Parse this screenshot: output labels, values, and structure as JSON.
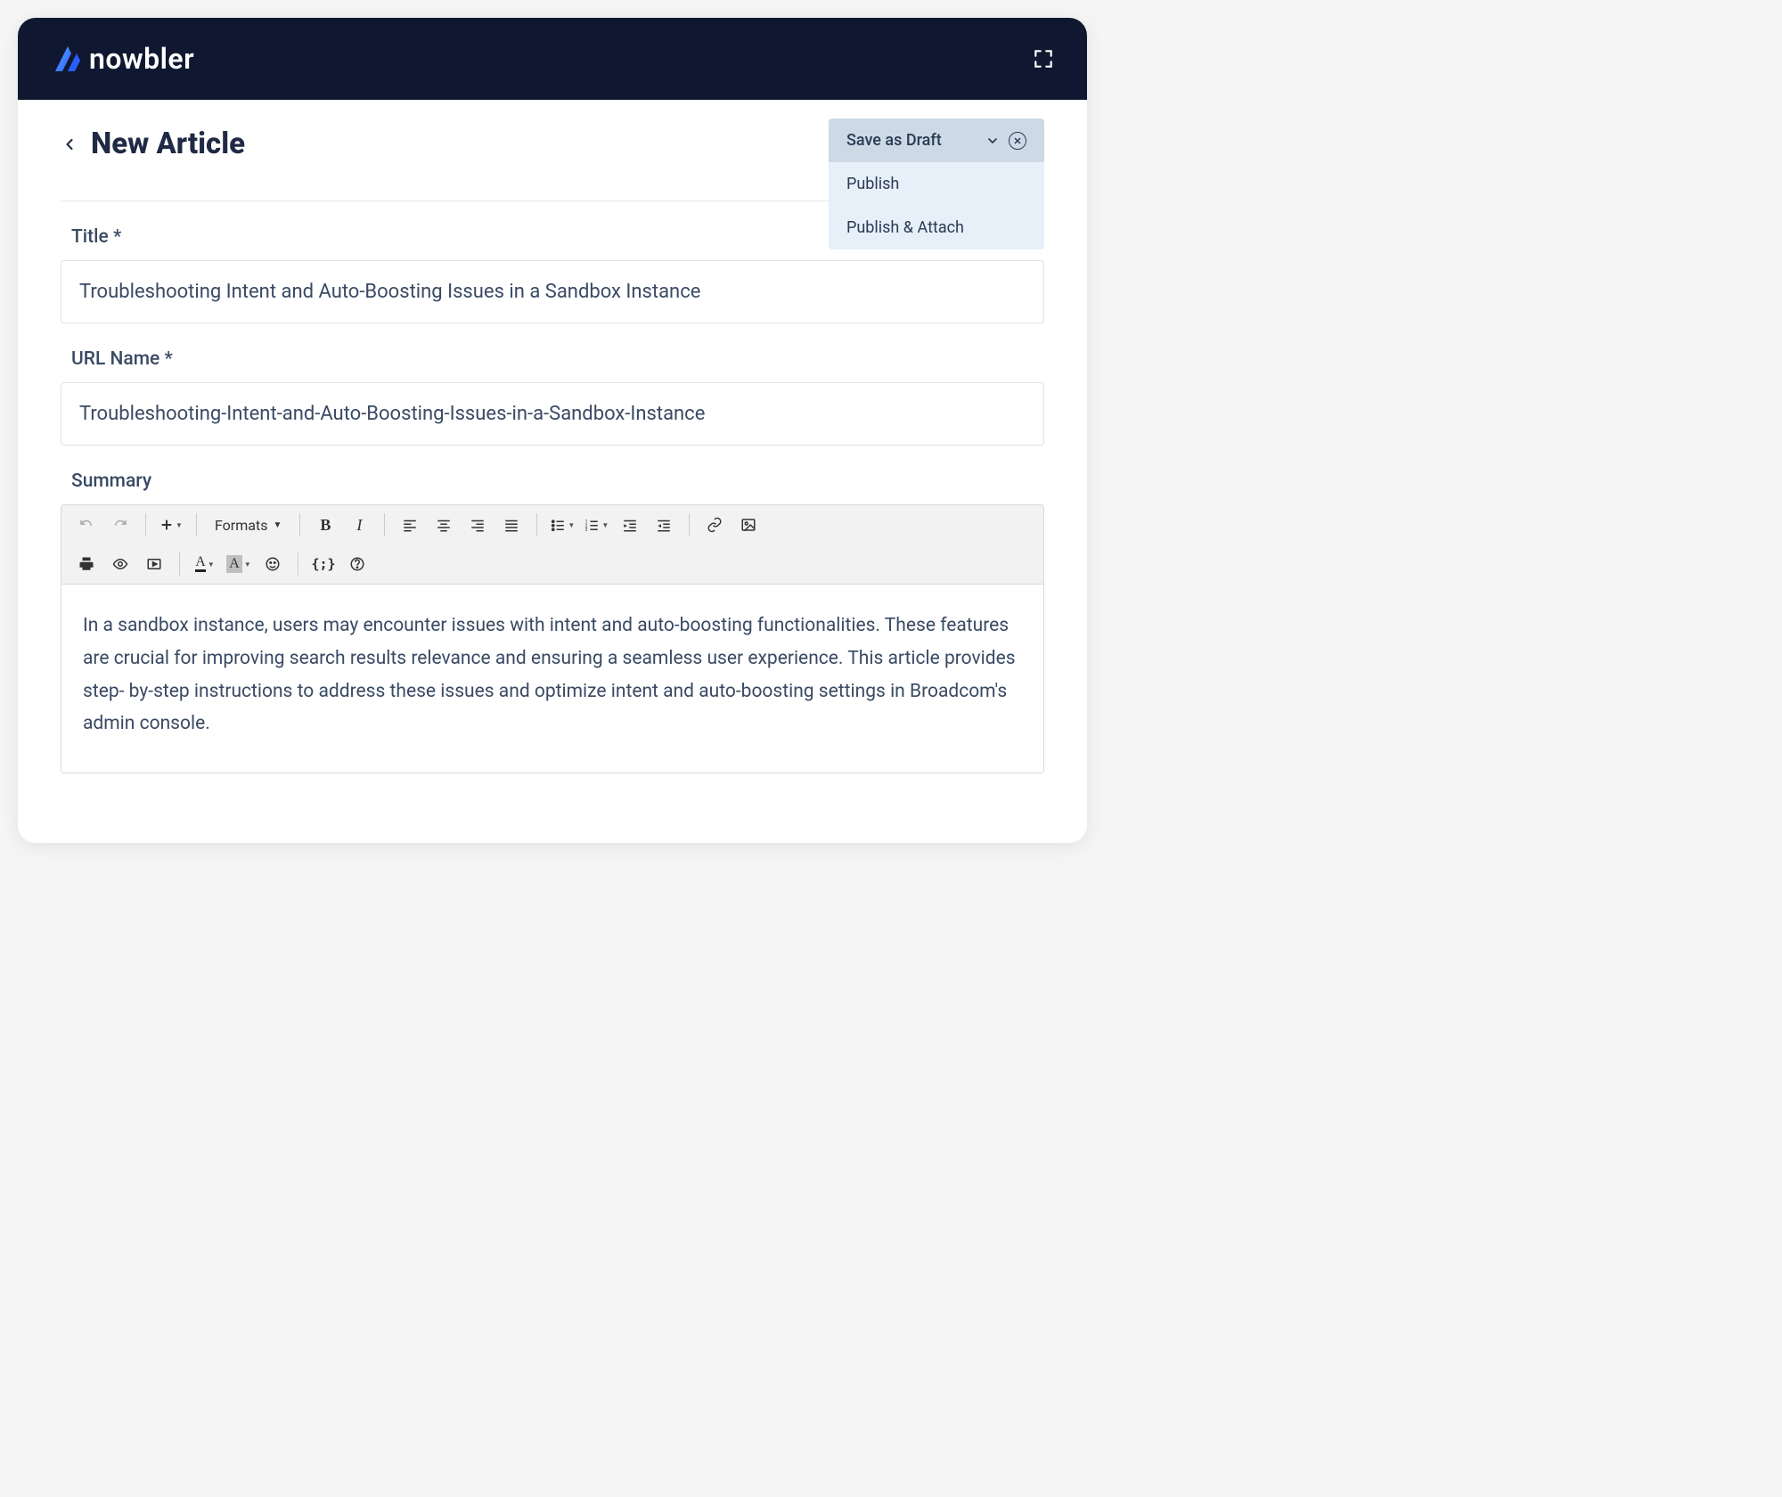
{
  "brand": {
    "name": "nowbler"
  },
  "page": {
    "title": "New Article"
  },
  "dropdown": {
    "primary": "Save as Draft",
    "option1": "Publish",
    "option2": "Publish & Attach"
  },
  "fields": {
    "title_label": "Title *",
    "title_value": "Troubleshooting Intent and Auto-Boosting Issues in a Sandbox Instance",
    "url_label": "URL Name *",
    "url_value": "Troubleshooting-Intent-and-Auto-Boosting-Issues-in-a-Sandbox-Instance",
    "summary_label": "Summary",
    "summary_body": "In a sandbox instance, users may encounter issues with intent and auto-boosting functionalities. These features are crucial for improving search results relevance and ensuring a seamless user experience. This article provides step- by-step instructions to address these issues and optimize  intent and auto-boosting  settings in Broadcom's admin console."
  },
  "toolbar": {
    "formats_label": "Formats"
  }
}
